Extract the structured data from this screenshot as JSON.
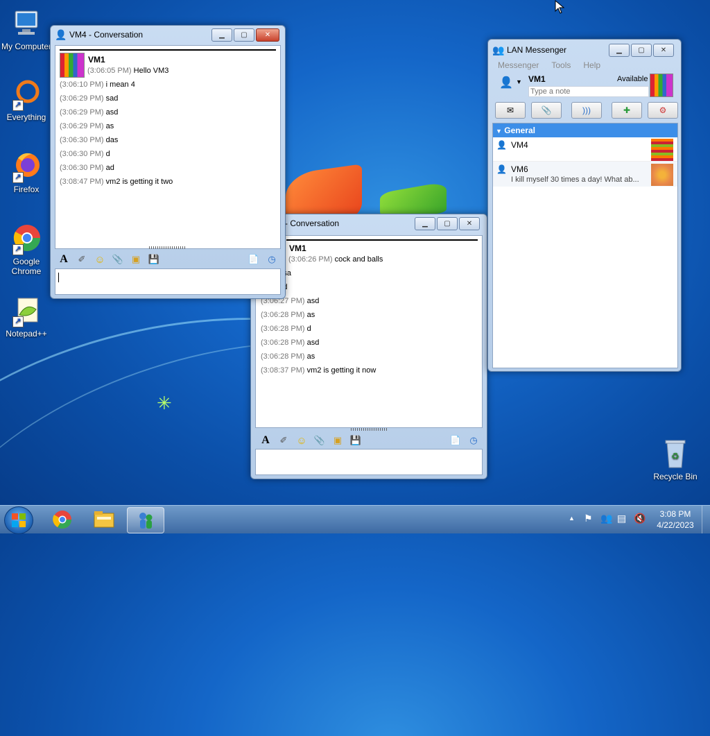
{
  "desktop": {
    "icons": [
      {
        "label": "My Computer",
        "icon": "computer-icon"
      },
      {
        "label": "Everything",
        "icon": "everything-icon"
      },
      {
        "label": "Firefox",
        "icon": "firefox-icon"
      },
      {
        "label": "Google Chrome",
        "icon": "chrome-icon"
      },
      {
        "label": "Notepad++",
        "icon": "notepadpp-icon"
      },
      {
        "label": "Recycle Bin",
        "icon": "recycle-bin-icon"
      }
    ]
  },
  "conv_vm4": {
    "title": "VM4 - Conversation",
    "sender": "VM1",
    "messages": [
      {
        "ts": "(3:06:05 PM)",
        "text": "Hello VM3"
      },
      {
        "ts": "(3:06:10 PM)",
        "text": "i mean 4"
      },
      {
        "ts": "(3:06:29 PM)",
        "text": "sad"
      },
      {
        "ts": "(3:06:29 PM)",
        "text": "asd"
      },
      {
        "ts": "(3:06:29 PM)",
        "text": "as"
      },
      {
        "ts": "(3:06:30 PM)",
        "text": "das"
      },
      {
        "ts": "(3:06:30 PM)",
        "text": "d"
      },
      {
        "ts": "(3:06:30 PM)",
        "text": "ad"
      },
      {
        "ts": "(3:08:47 PM)",
        "text": "vm2 is getting it two"
      }
    ],
    "input_value": ""
  },
  "conv_vm6": {
    "title": "6 - Conversation",
    "sender": "VM1",
    "messages": [
      {
        "ts": "(3:06:26 PM)",
        "text": "cock and balls"
      },
      {
        "ts": "7 PM)",
        "text": "sa"
      },
      {
        "ts": "7 PM)",
        "text": "d"
      },
      {
        "ts": "(3:06:27 PM)",
        "text": "asd"
      },
      {
        "ts": "(3:06:28 PM)",
        "text": "as"
      },
      {
        "ts": "(3:06:28 PM)",
        "text": "d"
      },
      {
        "ts": "(3:06:28 PM)",
        "text": "asd"
      },
      {
        "ts": "(3:06:28 PM)",
        "text": "as"
      },
      {
        "ts": "(3:08:37 PM)",
        "text": "vm2 is getting it now"
      }
    ],
    "input_value": ""
  },
  "messenger": {
    "title": "LAN Messenger",
    "menu": [
      "Messenger",
      "Tools",
      "Help"
    ],
    "user": "VM1",
    "status": "Available",
    "note_placeholder": "Type a note",
    "group": "General",
    "contacts": [
      {
        "name": "VM4",
        "note": ""
      },
      {
        "name": "VM6",
        "note": "I kill myself 30 times a day! What ab..."
      }
    ]
  },
  "taskbar": {
    "time": "3:08 PM",
    "date": "4/22/2023"
  },
  "colors": {
    "accent": "#3399ff",
    "title_blue": "#c9dcf2",
    "group_header": "#3c8ee8"
  }
}
